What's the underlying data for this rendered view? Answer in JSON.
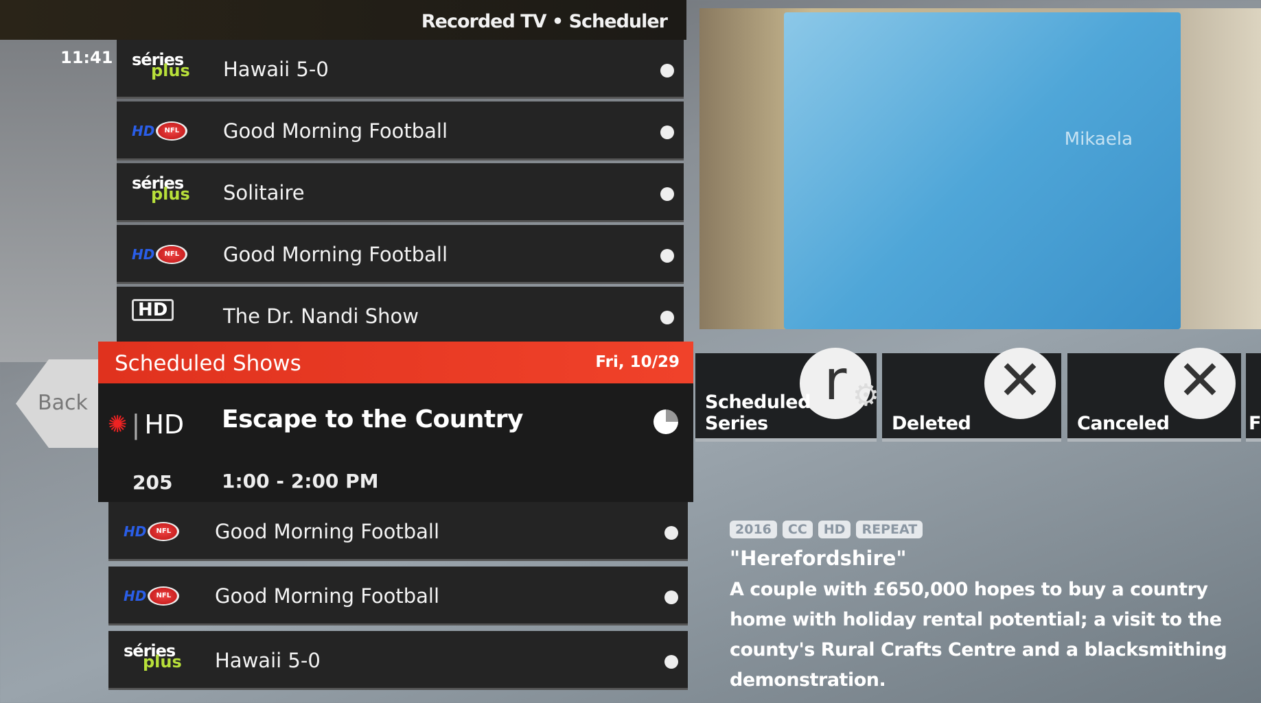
{
  "header": {
    "breadcrumb": "Recorded TV • Scheduler",
    "time": "11:41"
  },
  "logos": {
    "series_a": "séries",
    "series_b": "plus",
    "nfl_hd": "HD",
    "nfl": "NFL",
    "cbc_hd": "HD"
  },
  "rows_before": [
    {
      "channel": "series-plus",
      "title": "Hawaii 5-0"
    },
    {
      "channel": "nfl-hd",
      "title": "Good Morning Football"
    },
    {
      "channel": "series-plus",
      "title": "Solitaire"
    },
    {
      "channel": "nfl-hd",
      "title": "Good Morning Football"
    },
    {
      "channel": "cbc-hd",
      "title": "The Dr. Nandi Show"
    }
  ],
  "selected": {
    "section": "Scheduled Shows",
    "date": "Fri, 10/29",
    "title": "Escape to the Country",
    "channel_number": "205",
    "time": "1:00 - 2:00 PM"
  },
  "rows_after": [
    {
      "channel": "nfl-hd",
      "title": "Good Morning Football"
    },
    {
      "channel": "nfl-hd",
      "title": "Good Morning Football"
    },
    {
      "channel": "series-plus",
      "title": "Hawaii 5-0"
    }
  ],
  "back_label": "Back",
  "preview": {
    "overlay_text": "Mikaela"
  },
  "tiles": [
    {
      "label": "Scheduled Series",
      "icon": "series-gear-icon"
    },
    {
      "label": "Deleted",
      "icon": "x-icon"
    },
    {
      "label": "Canceled",
      "icon": "x-icon"
    },
    {
      "label": "F",
      "icon": ""
    }
  ],
  "details": {
    "badges": [
      "2016",
      "CC",
      "HD",
      "REPEAT"
    ],
    "episode": "\"Herefordshire\"",
    "description": "A couple with £650,000 hopes to buy a country home with holiday rental potential; a visit to the county's Rural Crafts Centre and a blacksmithing demonstration."
  },
  "colors": {
    "accent": "#e8381f"
  }
}
